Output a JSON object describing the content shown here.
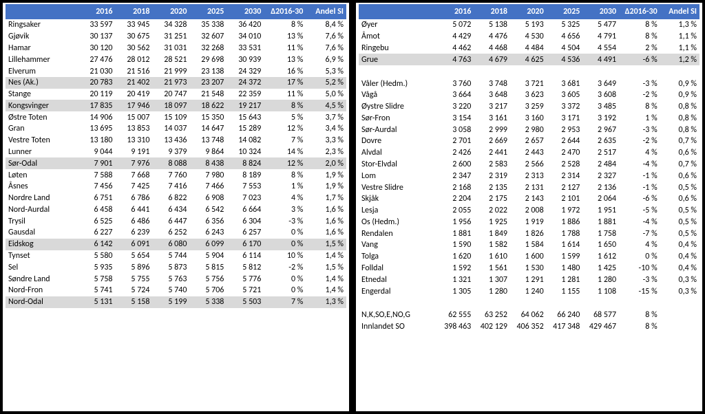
{
  "headers": {
    "name": "",
    "y2016": "2016",
    "y2018": "2018",
    "y2020": "2020",
    "y2025": "2025",
    "y2030": "2030",
    "delta": "Δ2016-30",
    "andel": "Andel SI"
  },
  "left": [
    {
      "name": "Ringsaker",
      "v": [
        "33 597",
        "33 945",
        "34 328",
        "35 338",
        "36 420",
        "8 %",
        "8,4 %"
      ],
      "shade": false
    },
    {
      "name": "Gjøvik",
      "v": [
        "30 137",
        "30 675",
        "31 251",
        "32 607",
        "34 010",
        "13 %",
        "7,6 %"
      ],
      "shade": false
    },
    {
      "name": "Hamar",
      "v": [
        "30 120",
        "30 562",
        "31 031",
        "32 268",
        "33 531",
        "11 %",
        "7,6 %"
      ],
      "shade": false
    },
    {
      "name": "Lillehammer",
      "v": [
        "27 476",
        "28 012",
        "28 521",
        "29 698",
        "30 939",
        "13 %",
        "6,9 %"
      ],
      "shade": false
    },
    {
      "name": "Elverum",
      "v": [
        "21 030",
        "21 516",
        "21 999",
        "23 138",
        "24 329",
        "16 %",
        "5,3 %"
      ],
      "shade": false
    },
    {
      "name": "Nes (Ak.)",
      "v": [
        "20 783",
        "21 402",
        "21 973",
        "23 207",
        "24 372",
        "17 %",
        "5,2 %"
      ],
      "shade": true
    },
    {
      "name": "Stange",
      "v": [
        "20 119",
        "20 419",
        "20 747",
        "21 548",
        "22 359",
        "11 %",
        "5,0 %"
      ],
      "shade": false
    },
    {
      "name": "Kongsvinger",
      "v": [
        "17 835",
        "17 946",
        "18 097",
        "18 622",
        "19 217",
        "8 %",
        "4,5 %"
      ],
      "shade": true
    },
    {
      "name": "Østre Toten",
      "v": [
        "14 906",
        "15 007",
        "15 109",
        "15 350",
        "15 643",
        "5 %",
        "3,7 %"
      ],
      "shade": false
    },
    {
      "name": "Gran",
      "v": [
        "13 695",
        "13 853",
        "14 037",
        "14 647",
        "15 289",
        "12 %",
        "3,4 %"
      ],
      "shade": false
    },
    {
      "name": "Vestre Toten",
      "v": [
        "13 180",
        "13 310",
        "13 436",
        "13 748",
        "14 082",
        "7 %",
        "3,3 %"
      ],
      "shade": false
    },
    {
      "name": "Lunner",
      "v": [
        "9 044",
        "9 191",
        "9 379",
        "9 864",
        "10 324",
        "14 %",
        "2,3 %"
      ],
      "shade": false
    },
    {
      "name": "Sør-Odal",
      "v": [
        "7 901",
        "7 976",
        "8 088",
        "8 438",
        "8 824",
        "12 %",
        "2,0 %"
      ],
      "shade": true
    },
    {
      "name": "Løten",
      "v": [
        "7 588",
        "7 668",
        "7 760",
        "7 980",
        "8 189",
        "8 %",
        "1,9 %"
      ],
      "shade": false
    },
    {
      "name": "Åsnes",
      "v": [
        "7 456",
        "7 425",
        "7 416",
        "7 466",
        "7 553",
        "1 %",
        "1,9 %"
      ],
      "shade": false
    },
    {
      "name": "Nordre Land",
      "v": [
        "6 751",
        "6 786",
        "6 822",
        "6 908",
        "7 023",
        "4 %",
        "1,7 %"
      ],
      "shade": false
    },
    {
      "name": "Nord-Aurdal",
      "v": [
        "6 458",
        "6 441",
        "6 434",
        "6 542",
        "6 664",
        "3 %",
        "1,6 %"
      ],
      "shade": false
    },
    {
      "name": "Trysil",
      "v": [
        "6 525",
        "6 486",
        "6 447",
        "6 356",
        "6 304",
        "-3 %",
        "1,6 %"
      ],
      "shade": false
    },
    {
      "name": "Gausdal",
      "v": [
        "6 227",
        "6 239",
        "6 252",
        "6 243",
        "6 257",
        "0 %",
        "1,6 %"
      ],
      "shade": false
    },
    {
      "name": "Eidskog",
      "v": [
        "6 142",
        "6 091",
        "6 080",
        "6 099",
        "6 170",
        "0 %",
        "1,5 %"
      ],
      "shade": true
    },
    {
      "name": "Tynset",
      "v": [
        "5 580",
        "5 654",
        "5 744",
        "5 904",
        "6 114",
        "10 %",
        "1,4 %"
      ],
      "shade": false
    },
    {
      "name": "Sel",
      "v": [
        "5 935",
        "5 896",
        "5 873",
        "5 815",
        "5 812",
        "-2 %",
        "1,5 %"
      ],
      "shade": false
    },
    {
      "name": "Søndre Land",
      "v": [
        "5 758",
        "5 755",
        "5 763",
        "5 756",
        "5 776",
        "0 %",
        "1,4 %"
      ],
      "shade": false
    },
    {
      "name": "Nord-Fron",
      "v": [
        "5 741",
        "5 724",
        "5 740",
        "5 706",
        "5 721",
        "0 %",
        "1,4 %"
      ],
      "shade": false
    },
    {
      "name": "Nord-Odal",
      "v": [
        "5 131",
        "5 158",
        "5 199",
        "5 338",
        "5 503",
        "7 %",
        "1,3 %"
      ],
      "shade": true
    }
  ],
  "right": [
    {
      "name": "Øyer",
      "v": [
        "5 072",
        "5 138",
        "5 193",
        "5 325",
        "5 477",
        "8 %",
        "1,3 %"
      ],
      "shade": false
    },
    {
      "name": "Åmot",
      "v": [
        "4 429",
        "4 476",
        "4 530",
        "4 656",
        "4 791",
        "8 %",
        "1,1 %"
      ],
      "shade": false
    },
    {
      "name": "Ringebu",
      "v": [
        "4 462",
        "4 468",
        "4 484",
        "4 504",
        "4 554",
        "2 %",
        "1,1 %"
      ],
      "shade": false
    },
    {
      "name": "Grue",
      "v": [
        "4 763",
        "4 679",
        "4 625",
        "4 536",
        "4 491",
        "-6 %",
        "1,2 %"
      ],
      "shade": true
    },
    {
      "blank": true
    },
    {
      "name": "Våler (Hedm.)",
      "v": [
        "3 760",
        "3 748",
        "3 721",
        "3 681",
        "3 649",
        "-3 %",
        "0,9 %"
      ],
      "shade": false
    },
    {
      "name": "Vågå",
      "v": [
        "3 664",
        "3 648",
        "3 623",
        "3 605",
        "3 608",
        "-2 %",
        "0,9 %"
      ],
      "shade": false
    },
    {
      "name": "Øystre Slidre",
      "v": [
        "3 220",
        "3 217",
        "3 259",
        "3 372",
        "3 485",
        "8 %",
        "0,8 %"
      ],
      "shade": false
    },
    {
      "name": "Sør-Fron",
      "v": [
        "3 154",
        "3 161",
        "3 160",
        "3 171",
        "3 192",
        "1 %",
        "0,8 %"
      ],
      "shade": false
    },
    {
      "name": "Sør-Aurdal",
      "v": [
        "3 058",
        "2 999",
        "2 980",
        "2 953",
        "2 967",
        "-3 %",
        "0,8 %"
      ],
      "shade": false
    },
    {
      "name": "Dovre",
      "v": [
        "2 701",
        "2 669",
        "2 657",
        "2 644",
        "2 635",
        "-2 %",
        "0,7 %"
      ],
      "shade": false
    },
    {
      "name": "Alvdal",
      "v": [
        "2 426",
        "2 441",
        "2 443",
        "2 470",
        "2 517",
        "4 %",
        "0,6 %"
      ],
      "shade": false
    },
    {
      "name": "Stor-Elvdal",
      "v": [
        "2 600",
        "2 583",
        "2 566",
        "2 528",
        "2 484",
        "-4 %",
        "0,7 %"
      ],
      "shade": false
    },
    {
      "name": "Lom",
      "v": [
        "2 347",
        "2 319",
        "2 313",
        "2 314",
        "2 327",
        "-1 %",
        "0,6 %"
      ],
      "shade": false
    },
    {
      "name": "Vestre Slidre",
      "v": [
        "2 168",
        "2 135",
        "2 131",
        "2 127",
        "2 136",
        "-1 %",
        "0,5 %"
      ],
      "shade": false
    },
    {
      "name": "Skjåk",
      "v": [
        "2 204",
        "2 175",
        "2 143",
        "2 101",
        "2 064",
        "-6 %",
        "0,6 %"
      ],
      "shade": false
    },
    {
      "name": "Lesja",
      "v": [
        "2 055",
        "2 022",
        "2 008",
        "1 972",
        "1 951",
        "-5 %",
        "0,5 %"
      ],
      "shade": false
    },
    {
      "name": "Os (Hedm.)",
      "v": [
        "1 956",
        "1 925",
        "1 919",
        "1 886",
        "1 881",
        "-4 %",
        "0,5 %"
      ],
      "shade": false
    },
    {
      "name": "Rendalen",
      "v": [
        "1 881",
        "1 849",
        "1 826",
        "1 788",
        "1 758",
        "-7 %",
        "0,5 %"
      ],
      "shade": false
    },
    {
      "name": "Vang",
      "v": [
        "1 590",
        "1 582",
        "1 584",
        "1 614",
        "1 650",
        "4 %",
        "0,4 %"
      ],
      "shade": false
    },
    {
      "name": "Tolga",
      "v": [
        "1 620",
        "1 610",
        "1 600",
        "1 599",
        "1 612",
        "0 %",
        "0,4 %"
      ],
      "shade": false
    },
    {
      "name": "Folldal",
      "v": [
        "1 592",
        "1 561",
        "1 530",
        "1 480",
        "1 425",
        "-10 %",
        "0,4 %"
      ],
      "shade": false
    },
    {
      "name": "Etnedal",
      "v": [
        "1 321",
        "1 307",
        "1 291",
        "1 281",
        "1 280",
        "-3 %",
        "0,3 %"
      ],
      "shade": false
    },
    {
      "name": "Engerdal",
      "v": [
        "1 305",
        "1 280",
        "1 240",
        "1 155",
        "1 108",
        "-15 %",
        "0,3 %"
      ],
      "shade": false
    },
    {
      "blank": true
    }
  ],
  "totals": [
    {
      "name": "N,K,SO,E,NO,G",
      "v": [
        "62 555",
        "63 252",
        "64 062",
        "66 240",
        "68 577",
        "8 %",
        ""
      ],
      "bold": false
    },
    {
      "name": "Innlandet SO",
      "v": [
        "398 463",
        "402 129",
        "406 352",
        "417 348",
        "429 467",
        "8 %",
        ""
      ],
      "bold": false
    }
  ]
}
